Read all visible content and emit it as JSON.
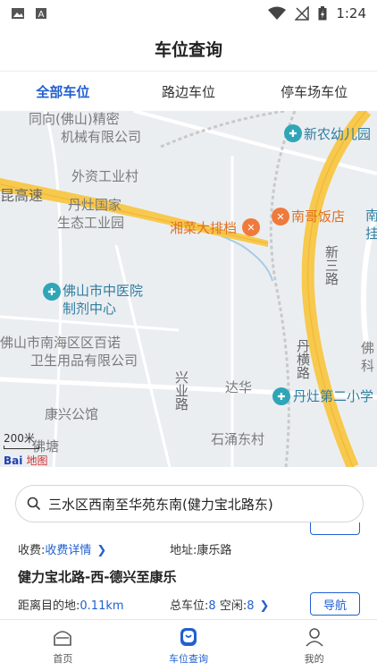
{
  "status_bar": {
    "time": "1:24",
    "icons": [
      "image-icon",
      "text-a-icon",
      "wifi-icon",
      "no-signal-icon",
      "battery-charging-icon"
    ]
  },
  "header": {
    "title": "车位查询"
  },
  "tabs": [
    {
      "label": "全部车位",
      "active": true
    },
    {
      "label": "路边车位",
      "active": false
    },
    {
      "label": "停车场车位",
      "active": false
    }
  ],
  "map": {
    "labels": {
      "l1": "同向(佛山)精密",
      "l2": "机械有限公司",
      "l3": "新农幼儿园",
      "l4": "外资工业村",
      "l5": "昆高速",
      "l6": "丹灶国家",
      "l7": "生态工业园",
      "l8": "湘菜大排档",
      "l9": "南哥饭店",
      "l10": "南",
      "l11": "挂",
      "l12": "新三路",
      "l13": "佛山市中医院",
      "l14": "制剂中心",
      "l15": "佛山市南海区区百诺",
      "l16": "卫生用品有限公司",
      "l17": "丹横路",
      "l18": "佛",
      "l19": "科",
      "l20": "兴业路",
      "l21": "达华",
      "l22": "丹灶第二小学",
      "l23": "康兴公馆",
      "l24": "石涌东村",
      "l25": "佛塘"
    },
    "scale": "200米",
    "logo_left": "Bai",
    "logo_right": "地图"
  },
  "search": {
    "value": "三水区西南至华苑东南(健力宝北路东)"
  },
  "parking": {
    "fee_label": "收费:",
    "fee_link": "收费详情",
    "address": "地址:康乐路",
    "title": "健力宝北路-西-德兴至康乐",
    "distance_label": "距离目的地:",
    "distance_value": "0.11km",
    "total_label": "总车位:",
    "total_value": "8",
    "free_label": "空闲:",
    "free_value": "8",
    "nav_button": "导航"
  },
  "bottom_nav": [
    {
      "label": "首页",
      "icon": "home-icon",
      "active": false
    },
    {
      "label": "车位查询",
      "icon": "parking-query-icon",
      "active": true
    },
    {
      "label": "我的",
      "icon": "user-icon",
      "active": false
    }
  ]
}
